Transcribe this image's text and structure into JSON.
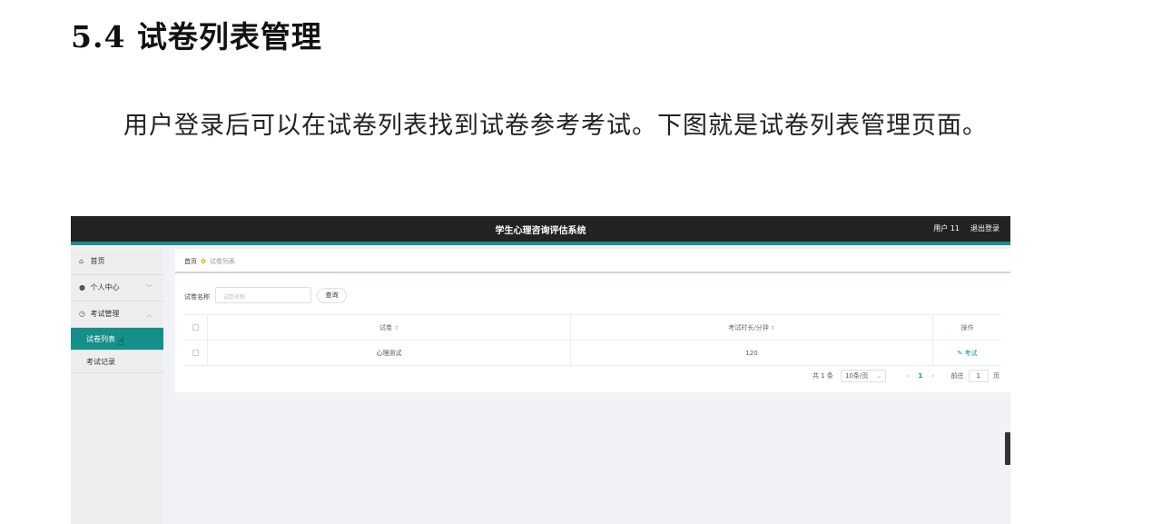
{
  "doc": {
    "heading": "5.4 试卷列表管理",
    "paragraph": "用户登录后可以在试卷列表找到试卷参考考试。下图就是试卷列表管理页面。"
  },
  "app": {
    "title": "学生心理咨询评估系统",
    "user": "用户 11",
    "logout": "退出登录"
  },
  "sidebar": {
    "items": [
      {
        "icon": "home-icon",
        "label": "首页"
      },
      {
        "icon": "user-icon",
        "label": "个人中心"
      },
      {
        "icon": "clock-icon",
        "label": "考试管理"
      }
    ],
    "sub_items": [
      {
        "label": "试卷列表",
        "active": true
      },
      {
        "label": "考试记录",
        "active": false
      }
    ]
  },
  "breadcrumb": {
    "home": "首页",
    "current": "试卷列表"
  },
  "search": {
    "label": "试卷名称",
    "placeholder": "试卷名称",
    "button": "查询"
  },
  "table": {
    "headers": [
      "试卷",
      "考试时长/分钟",
      "操作"
    ],
    "rows": [
      {
        "name": "心理测试",
        "duration": "120",
        "action": "考试"
      }
    ]
  },
  "pager": {
    "total": "共 1 条",
    "page_size": "10条/页",
    "current_page": "1",
    "goto_label": "前往",
    "goto_value": "1",
    "goto_suffix": "页"
  },
  "colors": {
    "accent": "#158f8a",
    "topbar": "#232323"
  }
}
